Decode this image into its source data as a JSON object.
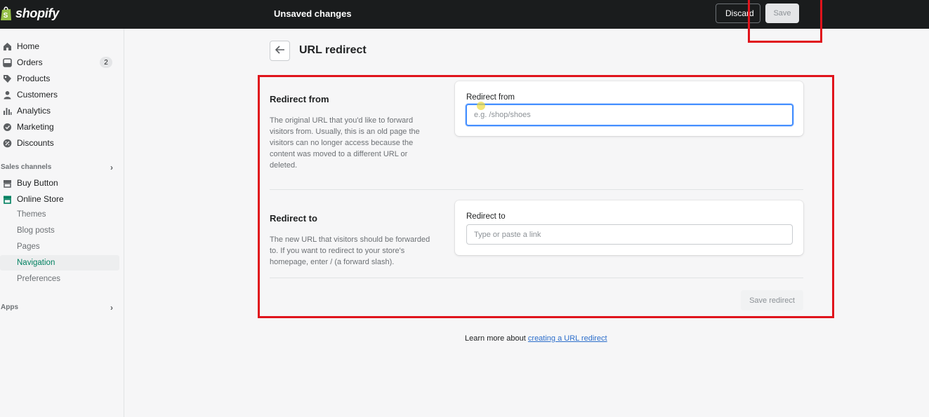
{
  "topbar": {
    "logo_text": "shopify",
    "status": "Unsaved changes",
    "discard_label": "Discard",
    "save_label": "Save"
  },
  "sidebar": {
    "items": [
      {
        "label": "Home",
        "icon": "home-icon"
      },
      {
        "label": "Orders",
        "icon": "orders-icon",
        "badge": "2"
      },
      {
        "label": "Products",
        "icon": "tag-icon"
      },
      {
        "label": "Customers",
        "icon": "person-icon"
      },
      {
        "label": "Analytics",
        "icon": "bar-chart-icon"
      },
      {
        "label": "Marketing",
        "icon": "marketing-icon"
      },
      {
        "label": "Discounts",
        "icon": "discount-icon"
      }
    ],
    "sales_channels_label": "Sales channels",
    "channels": [
      {
        "label": "Buy Button",
        "icon": "buy-button-icon"
      },
      {
        "label": "Online Store",
        "icon": "store-icon"
      }
    ],
    "store_sub": [
      {
        "label": "Themes"
      },
      {
        "label": "Blog posts"
      },
      {
        "label": "Pages"
      },
      {
        "label": "Navigation",
        "active": true
      },
      {
        "label": "Preferences"
      }
    ],
    "apps_label": "Apps"
  },
  "page": {
    "title": "URL redirect"
  },
  "redirect_from": {
    "section_title": "Redirect from",
    "description": "The original URL that you'd like to forward visitors from. Usually, this is an old page the visitors can no longer access because the content was moved to a different URL or deleted.",
    "field_label": "Redirect from",
    "placeholder": "e.g. /shop/shoes",
    "value": ""
  },
  "redirect_to": {
    "section_title": "Redirect to",
    "description": "The new URL that visitors should be forwarded to. If you want to redirect to your store's homepage, enter / (a forward slash).",
    "field_label": "Redirect to",
    "placeholder": "Type or paste a link",
    "value": ""
  },
  "actions": {
    "save_redirect_label": "Save redirect"
  },
  "footer": {
    "learn_prefix": "Learn more about",
    "learn_link": "creating a URL redirect"
  },
  "colors": {
    "topbar": "#1a1c1d",
    "accent_green": "#008060",
    "annotation_red": "#e0141c",
    "focus_blue": "#458fff"
  }
}
